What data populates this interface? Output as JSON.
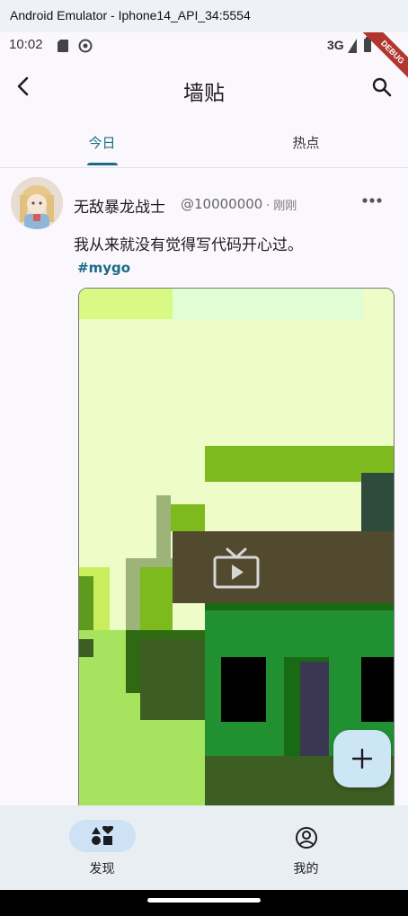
{
  "window": {
    "title": "Android Emulator - Iphone14_API_34:5554"
  },
  "status_bar": {
    "time": "10:02",
    "network": "3G",
    "debug_banner": "DEBUG"
  },
  "app_bar": {
    "title": "墙贴",
    "back_icon": "arrow-back-icon",
    "search_icon": "search-icon"
  },
  "tabs": [
    {
      "label": "今日",
      "selected": true
    },
    {
      "label": "热点",
      "selected": false
    }
  ],
  "post": {
    "username": "无敌暴龙战士",
    "handle": "@10000000",
    "separator": "·",
    "time": "刚刚",
    "content": "我从来就没有觉得写代码开心过。",
    "tag": "#mygo",
    "media_type": "video",
    "more_icon": "more-horizontal-icon"
  },
  "fab": {
    "icon": "add-icon"
  },
  "bottom_nav": [
    {
      "label": "发现",
      "icon": "category-icon",
      "selected": true
    },
    {
      "label": "我的",
      "icon": "account-circle-icon",
      "selected": false
    }
  ],
  "colors": {
    "accent": "#196b86",
    "nav_pill": "#cde3f5",
    "fab_bg": "#cde6f6",
    "debug_banner": "#b1372e"
  }
}
